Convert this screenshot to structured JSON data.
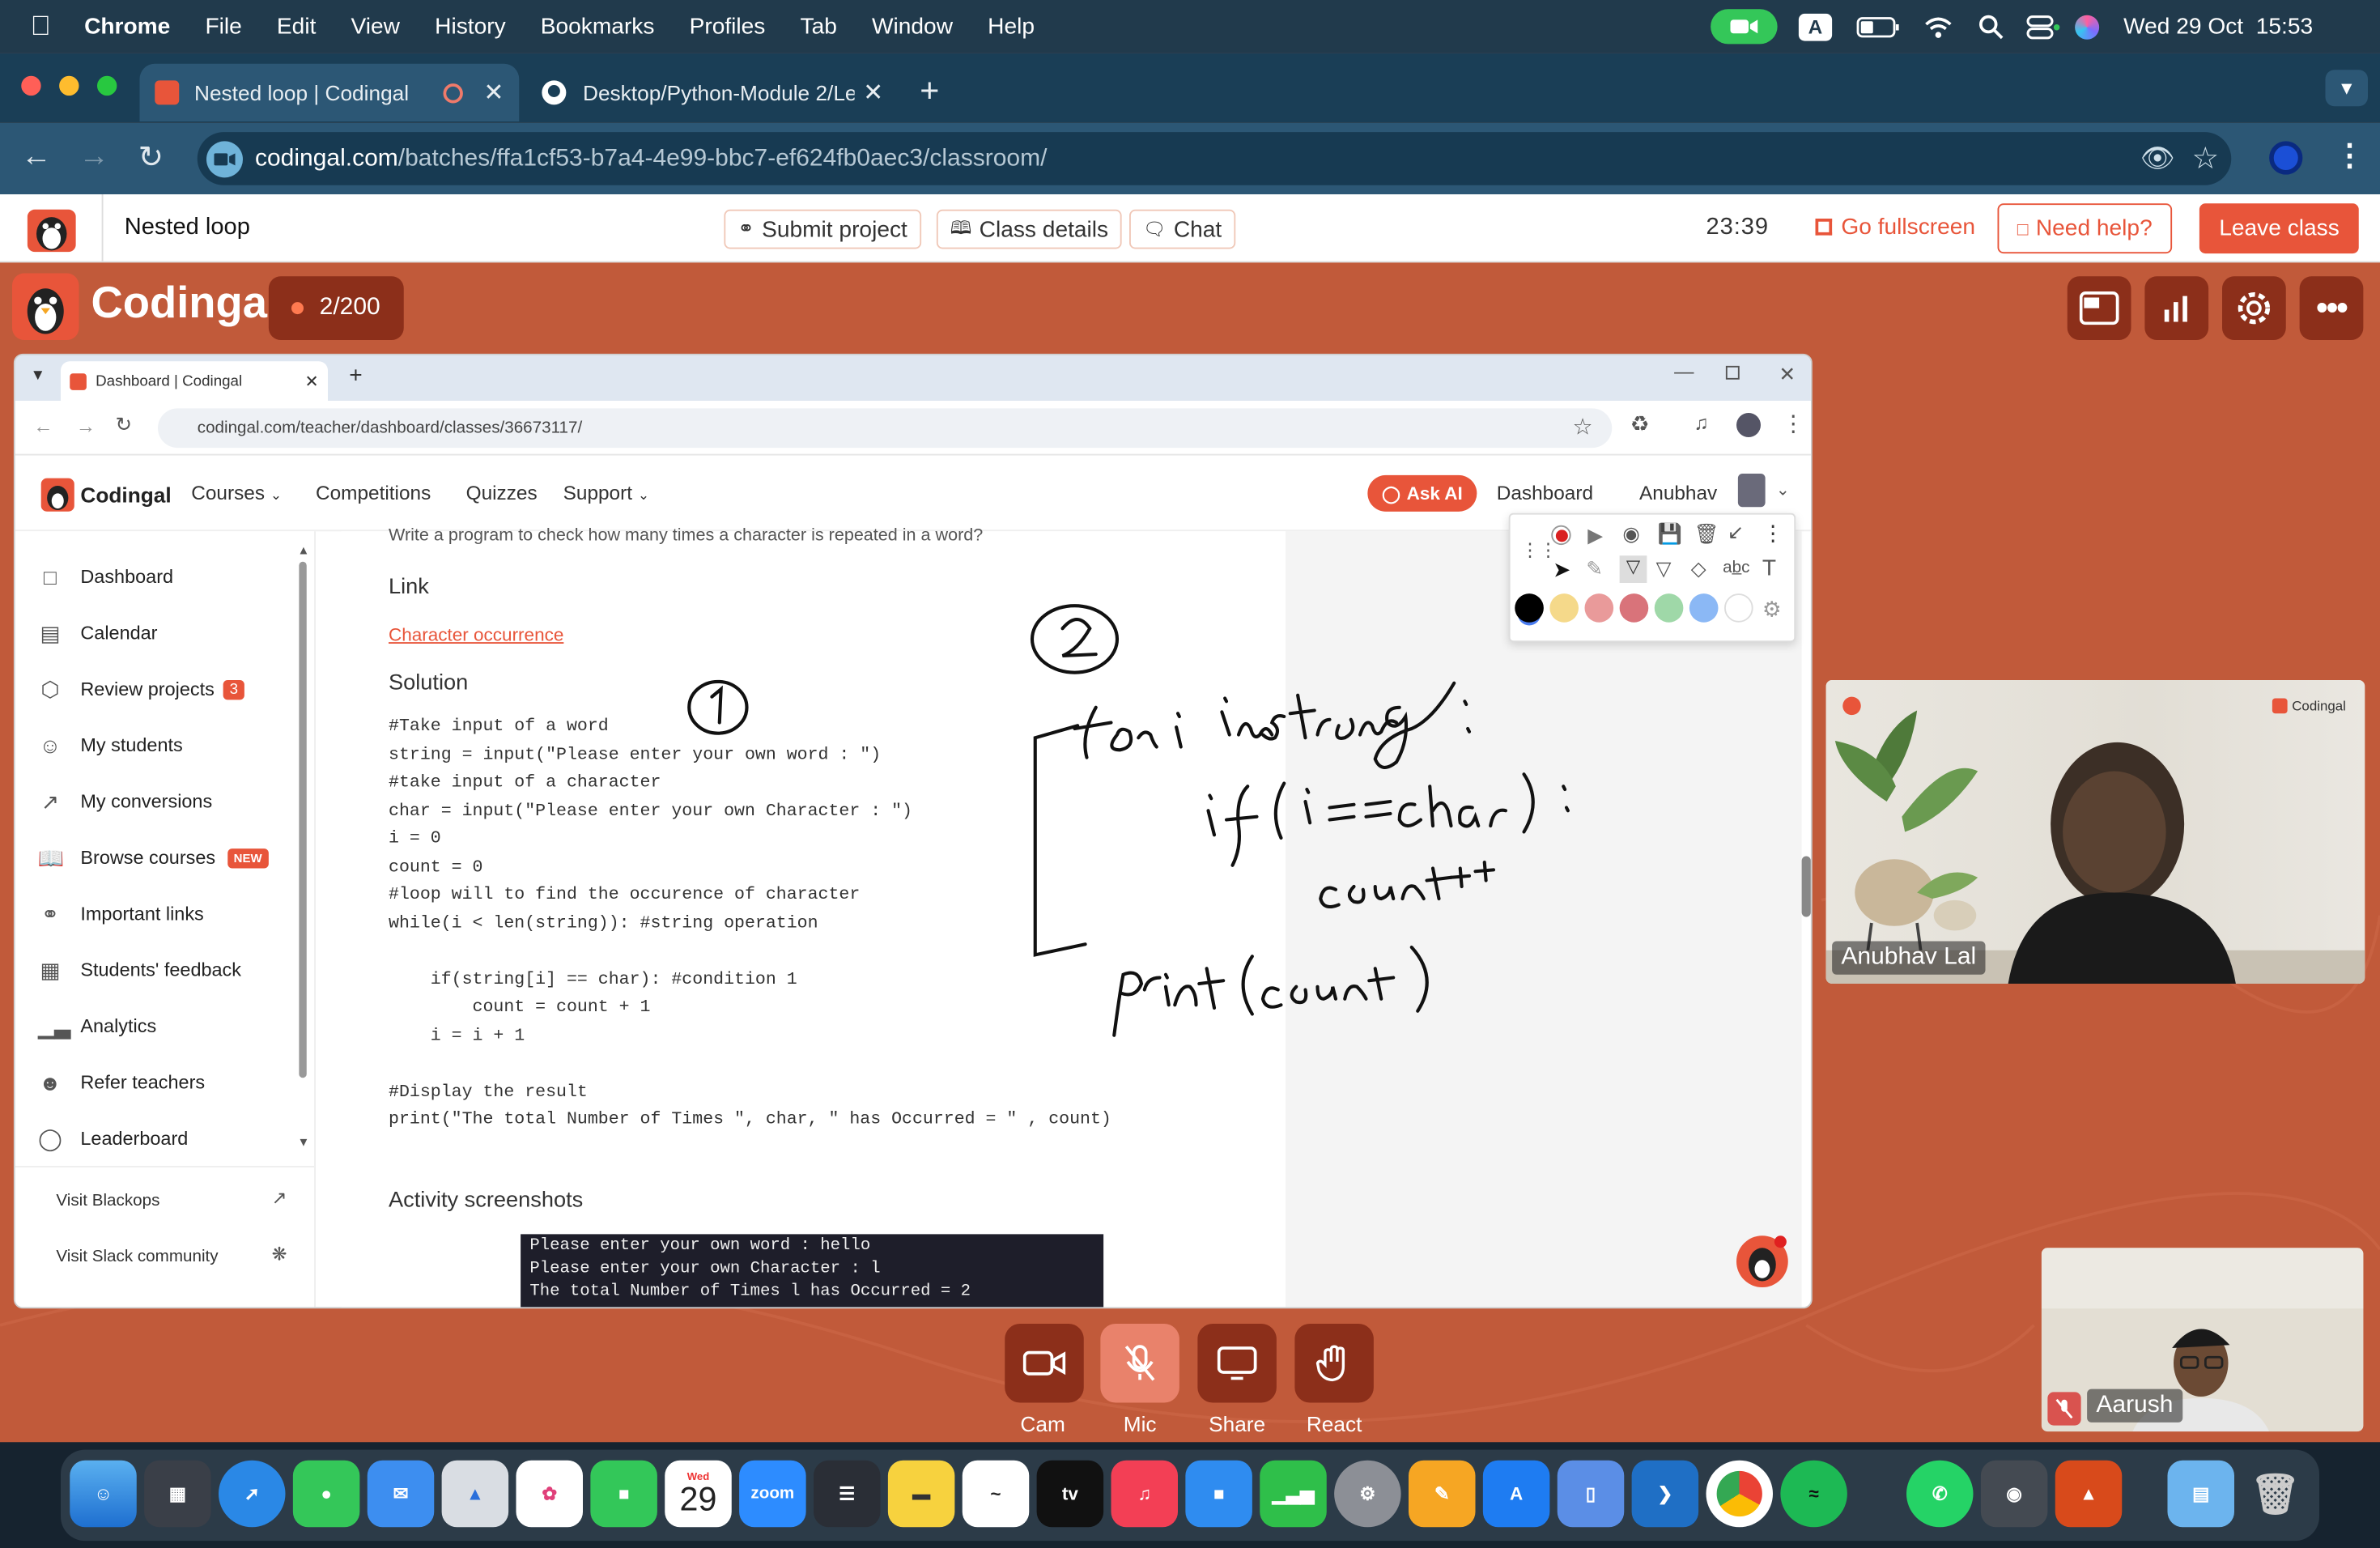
{
  "menubar": {
    "app": "Chrome",
    "items": [
      "File",
      "Edit",
      "View",
      "History",
      "Bookmarks",
      "Profiles",
      "Tab",
      "Window",
      "Help"
    ],
    "datetime": "Wed 29 Oct  15:53",
    "input_badge": "A"
  },
  "chrome": {
    "tab1": "Nested loop | Codingal",
    "tab2": "Desktop/Python-Module 2/Le",
    "url_host": "codingal.com",
    "url_path": "/batches/ffa1cf53-b7a4-4e99-bbc7-ef624fb0aec3/classroom/"
  },
  "header": {
    "title": "Nested loop",
    "submit": "Submit project",
    "details": "Class details",
    "chat": "Chat",
    "timer": "23:39",
    "fullscreen": "Go fullscreen",
    "help": "Need help?",
    "leave": "Leave class"
  },
  "classroom": {
    "brand": "Codingal",
    "counter": "2/200"
  },
  "inner": {
    "tab": "Dashboard | Codingal",
    "url": "codingal.com/teacher/dashboard/classes/36673117/",
    "brand": "Codingal",
    "nav": [
      "Courses",
      "Competitions",
      "Quizzes",
      "Support"
    ],
    "ask_ai": "Ask AI",
    "dashboard": "Dashboard",
    "user": "Anubhav",
    "sidebar": [
      {
        "label": "Dashboard"
      },
      {
        "label": "Calendar"
      },
      {
        "label": "Review projects",
        "badge": "3"
      },
      {
        "label": "My students"
      },
      {
        "label": "My conversions"
      },
      {
        "label": "Browse courses",
        "badge": "NEW"
      },
      {
        "label": "Important links"
      },
      {
        "label": "Students' feedback"
      },
      {
        "label": "Analytics"
      },
      {
        "label": "Refer teachers"
      },
      {
        "label": "Leaderboard"
      }
    ],
    "visit_blackops": "Visit Blackops",
    "visit_slack": "Visit Slack community",
    "question": "Write a program to check how many times a character is repeated in a word?",
    "link_heading": "Link",
    "link_text": "Character occurrence",
    "solution_heading": "Solution",
    "code": [
      "#Take input of a word",
      "string = input(\"Please enter your own word : \")",
      "#take input of a character",
      "char = input(\"Please enter your own Character : \")",
      "i = 0",
      "count = 0",
      "#loop will to find the occurence of character",
      "while(i < len(string)): #string operation",
      "",
      "    if(string[i] == char): #condition 1",
      "        count = count + 1",
      "    i = i + 1",
      "",
      "#Display the result",
      "print(\"The total Number of Times \", char, \" has Occurred = \" , count)"
    ],
    "activity_heading": "Activity screenshots",
    "terminal": [
      "Please enter your own word : hello",
      "Please enter your own Character : l",
      "The total Number of Times  l  has Occurred =  2"
    ],
    "annotation_colors": [
      "#000000",
      "#f5d98a",
      "#e99a9a",
      "#d9737a",
      "#9fd8a8",
      "#8bb8f5",
      "#ffffff"
    ]
  },
  "videos": {
    "teacher": "Anubhav Lal",
    "tile_brand": "Codingal",
    "student": "Aarush"
  },
  "controls": [
    "Cam",
    "Mic",
    "Share",
    "React"
  ],
  "dock": {
    "date_month": "Wed",
    "date_day": "29",
    "zoom": "zoom"
  }
}
